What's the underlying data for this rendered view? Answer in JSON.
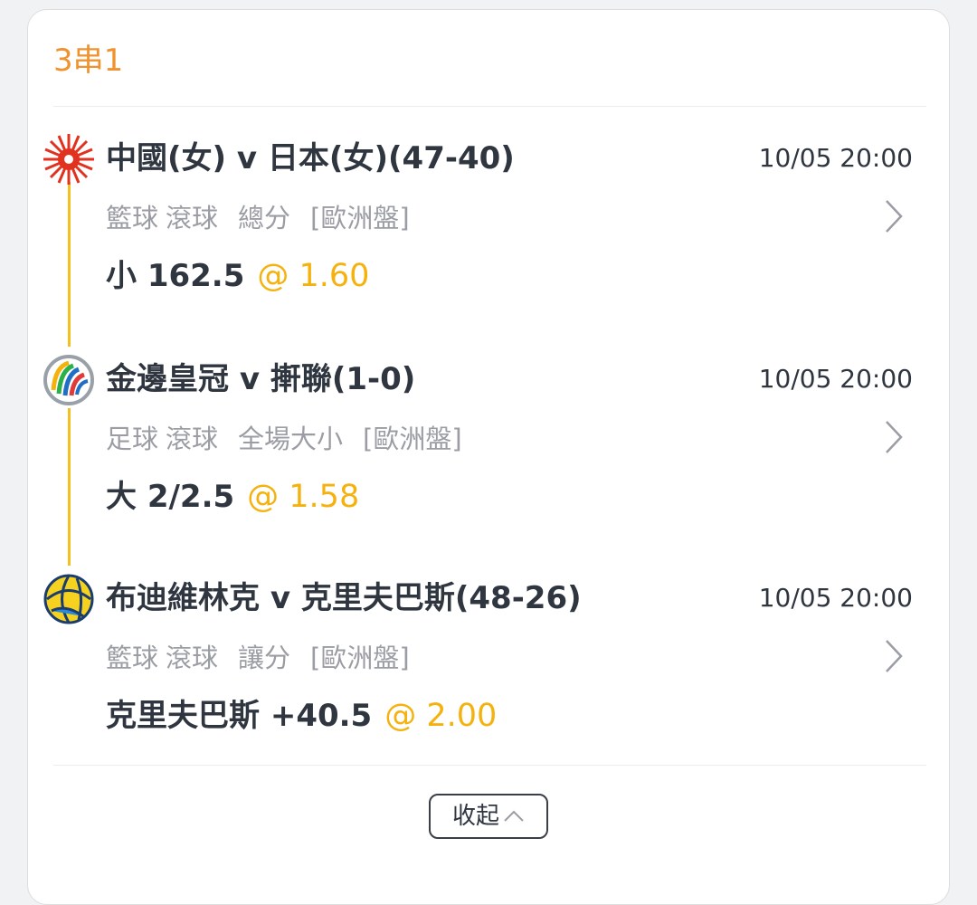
{
  "card": {
    "title": "3串1"
  },
  "legs": [
    {
      "title": "中國(女) v 日本(女)(47-40)",
      "time": "10/05 20:00",
      "sport": "籃球",
      "inplay": "滾球",
      "market": "總分",
      "odds_type": "[歐洲盤]",
      "selection": "小 162.5",
      "odds": "@ 1.60",
      "icon": "sunburst-logo-icon"
    },
    {
      "title": "金邊皇冠 v 搟聯(1-0)",
      "time": "10/05 20:00",
      "sport": "足球",
      "inplay": "滾球",
      "market": "全場大小",
      "odds_type": "[歐洲盤]",
      "selection": "大 2/2.5",
      "odds": "@ 1.58",
      "icon": "afc-cup-logo-icon"
    },
    {
      "title": "布迪維林克 v 克里夫巴斯(48-26)",
      "time": "10/05 20:00",
      "sport": "籃球",
      "inplay": "滾球",
      "market": "讓分",
      "odds_type": "[歐洲盤]",
      "selection": "克里夫巴斯 +40.5",
      "odds": "@ 2.00",
      "icon": "basketball-logo-icon"
    }
  ],
  "collapse": {
    "label": "收起"
  },
  "colors": {
    "accent": "#f0922f",
    "odds": "#f5b20f",
    "timeline": "#f3c01e",
    "text": "#2f3640",
    "muted": "#9a9da3"
  }
}
